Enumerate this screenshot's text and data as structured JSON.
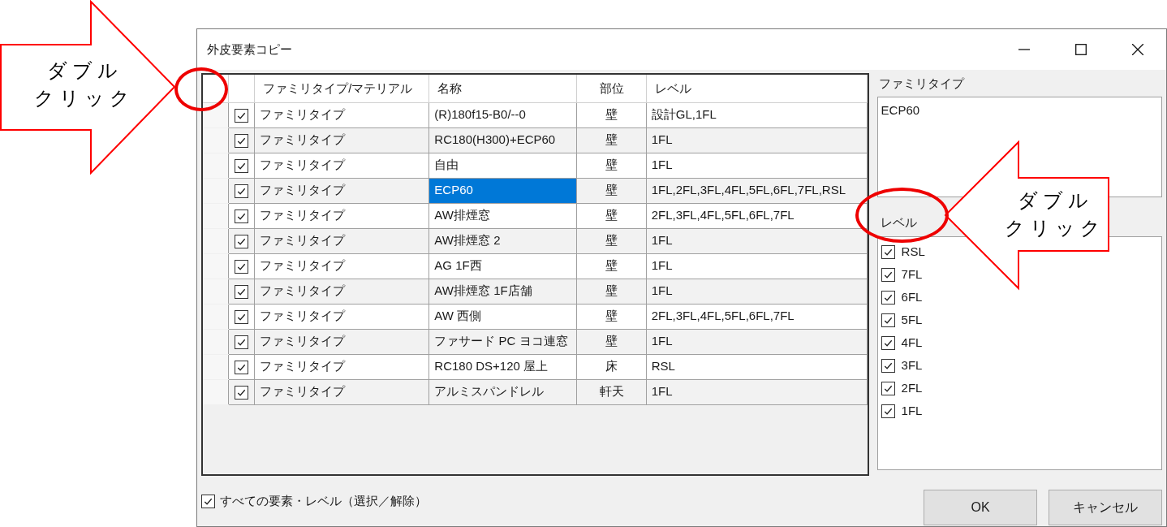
{
  "window": {
    "title": "外皮要素コピー"
  },
  "table": {
    "columns": [
      "ファミリタイプ/マテリアル",
      "名称",
      "部位",
      "レベル"
    ],
    "rows": [
      {
        "checked": true,
        "type": "ファミリタイプ",
        "name": "(R)180f15-B0/--0",
        "part": "壁",
        "level": "設計GL,1FL",
        "selected": false
      },
      {
        "checked": true,
        "type": "ファミリタイプ",
        "name": "RC180(H300)+ECP60",
        "part": "壁",
        "level": "1FL",
        "selected": false
      },
      {
        "checked": true,
        "type": "ファミリタイプ",
        "name": "自由",
        "part": "壁",
        "level": "1FL",
        "selected": false
      },
      {
        "checked": true,
        "type": "ファミリタイプ",
        "name": "ECP60",
        "part": "壁",
        "level": "1FL,2FL,3FL,4FL,5FL,6FL,7FL,RSL",
        "selected": true
      },
      {
        "checked": true,
        "type": "ファミリタイプ",
        "name": "AW排煙窓",
        "part": "壁",
        "level": "2FL,3FL,4FL,5FL,6FL,7FL",
        "selected": false
      },
      {
        "checked": true,
        "type": "ファミリタイプ",
        "name": "AW排煙窓 2",
        "part": "壁",
        "level": "1FL",
        "selected": false
      },
      {
        "checked": true,
        "type": "ファミリタイプ",
        "name": "AG 1F西",
        "part": "壁",
        "level": "1FL",
        "selected": false
      },
      {
        "checked": true,
        "type": "ファミリタイプ",
        "name": "AW排煙窓 1F店舗",
        "part": "壁",
        "level": "1FL",
        "selected": false
      },
      {
        "checked": true,
        "type": "ファミリタイプ",
        "name": "AW 西側",
        "part": "壁",
        "level": "2FL,3FL,4FL,5FL,6FL,7FL",
        "selected": false
      },
      {
        "checked": true,
        "type": "ファミリタイプ",
        "name": "ファサード PC ヨコ連窓",
        "part": "壁",
        "level": "1FL",
        "selected": false
      },
      {
        "checked": true,
        "type": "ファミリタイプ",
        "name": "RC180 DS+120 屋上",
        "part": "床",
        "level": "RSL",
        "selected": false
      },
      {
        "checked": true,
        "type": "ファミリタイプ",
        "name": "アルミスパンドレル",
        "part": "軒天",
        "level": "1FL",
        "selected": false
      }
    ]
  },
  "family_type": {
    "label": "ファミリタイプ",
    "value": "ECP60"
  },
  "levels": {
    "label": "レベル",
    "items": [
      {
        "label": "RSL",
        "checked": true
      },
      {
        "label": "7FL",
        "checked": true
      },
      {
        "label": "6FL",
        "checked": true
      },
      {
        "label": "5FL",
        "checked": true
      },
      {
        "label": "4FL",
        "checked": true
      },
      {
        "label": "3FL",
        "checked": true
      },
      {
        "label": "2FL",
        "checked": true
      },
      {
        "label": "1FL",
        "checked": true
      }
    ]
  },
  "select_all": {
    "label": "すべての要素・レベル（選択／解除）",
    "checked": true
  },
  "buttons": [
    "OK",
    "キャンセル"
  ],
  "annotations": [
    {
      "lines": [
        "ダブル",
        "クリック"
      ]
    },
    {
      "lines": [
        "ダブル",
        "クリック"
      ]
    }
  ]
}
